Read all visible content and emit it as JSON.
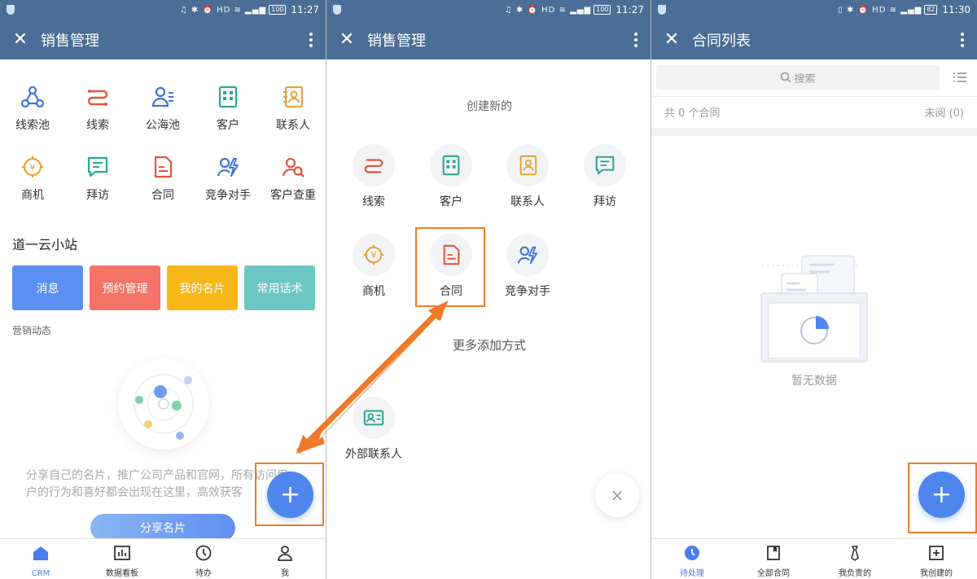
{
  "status": {
    "time1": "11:27",
    "time2": "11:27",
    "time3": "11:30",
    "battery1": "100",
    "battery2": "100",
    "battery3": "82"
  },
  "panel1": {
    "title": "销售管理",
    "grid": [
      {
        "label": "线索池",
        "icon": "clue-pool-icon",
        "color": "#3f74d6"
      },
      {
        "label": "线索",
        "icon": "clue-icon",
        "color": "#e2553a"
      },
      {
        "label": "公海池",
        "icon": "public-pool-icon",
        "color": "#3f74d6"
      },
      {
        "label": "客户",
        "icon": "customer-icon",
        "color": "#2aa88e"
      },
      {
        "label": "联系人",
        "icon": "contact-icon",
        "color": "#e6a33a"
      },
      {
        "label": "商机",
        "icon": "opportunity-icon",
        "color": "#e6a33a"
      },
      {
        "label": "拜访",
        "icon": "visit-icon",
        "color": "#2aa88e"
      },
      {
        "label": "合同",
        "icon": "contract-icon",
        "color": "#e2553a"
      },
      {
        "label": "竞争对手",
        "icon": "competitor-icon",
        "color": "#3f74d6"
      },
      {
        "label": "客户查重",
        "icon": "customer-dedupe-icon",
        "color": "#e2553a"
      }
    ],
    "section_title": "道一云小站",
    "cards": [
      {
        "label": "消息",
        "color": "#5b8ef0"
      },
      {
        "label": "预约管理",
        "color": "#f47266"
      },
      {
        "label": "我的名片",
        "color": "#f7b718"
      },
      {
        "label": "常用话术",
        "color": "#6cc7c3"
      }
    ],
    "sub_title": "营销动态",
    "promo_text": "分享自己的名片，推广公司产品和官网，所有访问用户的行为和喜好都会出现在这里，高效获客",
    "share_button": "分享名片",
    "fab": "+",
    "tabs": [
      {
        "label": "CRM",
        "icon": "home-icon"
      },
      {
        "label": "数据看板",
        "icon": "chart-icon"
      },
      {
        "label": "待办",
        "icon": "clock-icon"
      },
      {
        "label": "我",
        "icon": "person-icon"
      }
    ]
  },
  "panel2": {
    "title": "销售管理",
    "create_title": "创建新的",
    "items": [
      {
        "label": "线索",
        "icon": "clue-icon"
      },
      {
        "label": "客户",
        "icon": "customer-icon"
      },
      {
        "label": "联系人",
        "icon": "contact-icon"
      },
      {
        "label": "拜访",
        "icon": "visit-icon"
      },
      {
        "label": "商机",
        "icon": "opportunity-icon"
      },
      {
        "label": "合同",
        "icon": "contract-icon"
      },
      {
        "label": "竞争对手",
        "icon": "competitor-icon"
      }
    ],
    "more_ways": "更多添加方式",
    "external_contact": "外部联系人",
    "close": "×"
  },
  "panel3": {
    "title": "合同列表",
    "search_placeholder": "搜索",
    "count_text": "共 0 个合同",
    "unread_text": "未阅 (0)",
    "empty_text": "暂无数据",
    "fab": "+",
    "tabs": [
      {
        "label": "待处理",
        "icon": "clock-icon"
      },
      {
        "label": "全部合同",
        "icon": "book-icon"
      },
      {
        "label": "我负责的",
        "icon": "tie-icon"
      },
      {
        "label": "我创建的",
        "icon": "add-doc-icon"
      }
    ]
  },
  "colors": {
    "appbar": "#4a6e96",
    "accent": "#4f86ee",
    "highlight": "#f07a2a"
  }
}
